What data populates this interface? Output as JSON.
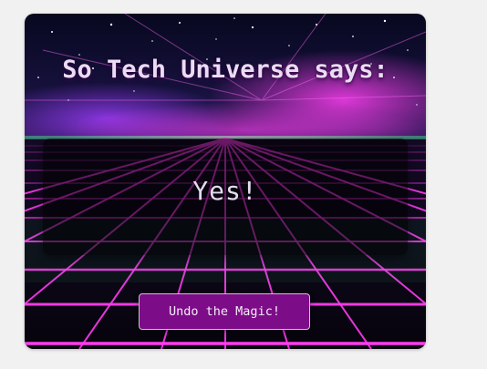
{
  "card": {
    "title": "So Tech Universe says:",
    "answer": "Yes!",
    "undo_label": "Undo the Magic!"
  },
  "colors": {
    "accent": "#7c0c87",
    "grid": "#ff3cf0",
    "sky_top": "#0a0a2a",
    "horizon_glow": "#d33be0"
  }
}
